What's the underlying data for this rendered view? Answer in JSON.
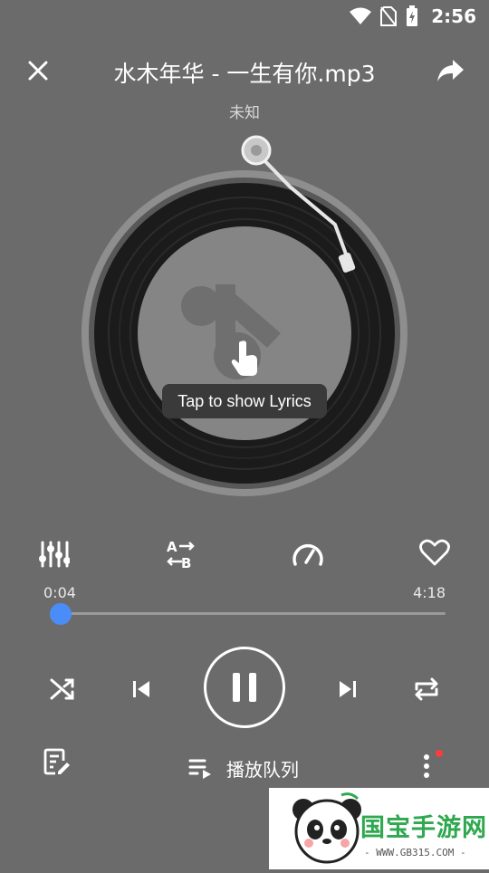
{
  "status_bar": {
    "time": "2:56",
    "icons": [
      "wifi-icon",
      "no-sim-icon",
      "battery-charging-icon"
    ]
  },
  "header": {
    "title": "水木年华 - 一生有你.mp3",
    "artist": "未知"
  },
  "record": {
    "tooltip": "Tap to show Lyrics"
  },
  "actions": [
    "equalizer-icon",
    "ab-repeat-icon",
    "speed-icon",
    "heart-icon"
  ],
  "progress": {
    "current": "0:04",
    "total": "4:18",
    "fraction": 0.016
  },
  "controls": [
    "shuffle-icon",
    "previous-icon",
    "pause-icon",
    "next-icon",
    "repeat-icon"
  ],
  "bottom": {
    "queue_label": "播放队列",
    "has_notification": true
  },
  "watermark": {
    "title": "国宝手游网",
    "url": "- WWW.GB315.COM -"
  },
  "colors": {
    "background": "#6b6b6b",
    "accent": "#4b8df8",
    "dot": "#ff3b3b"
  }
}
